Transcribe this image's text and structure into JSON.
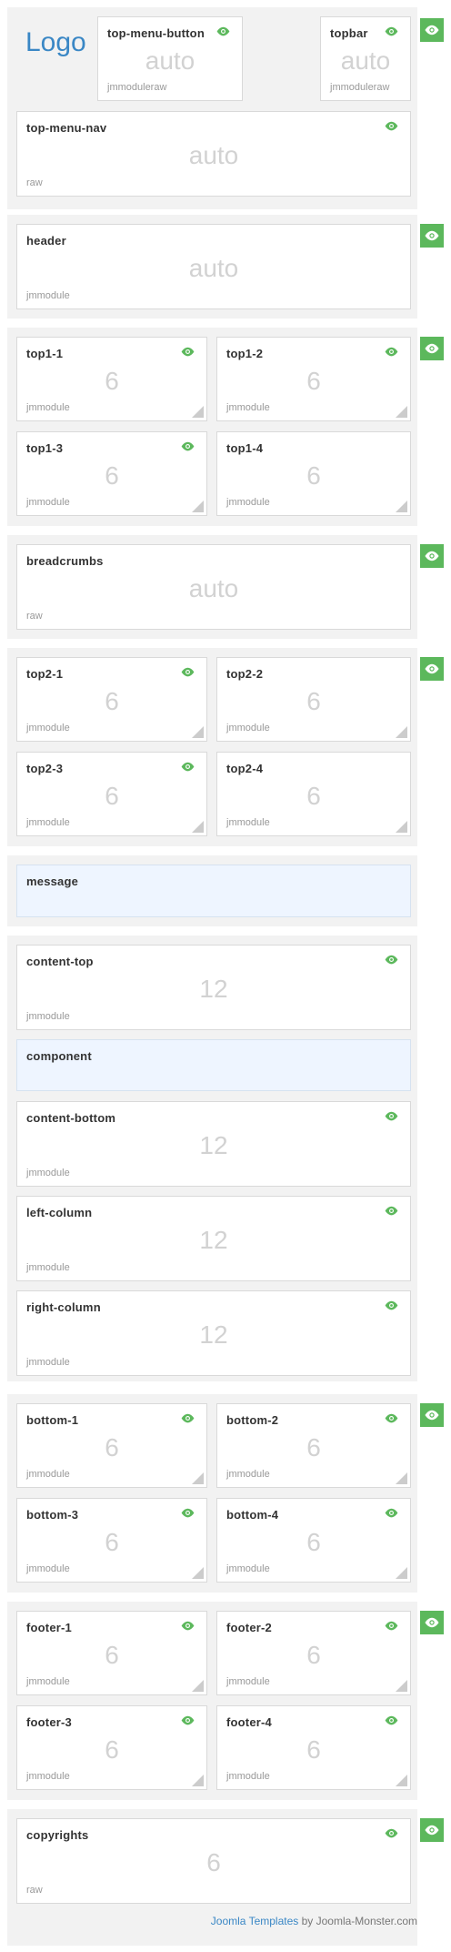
{
  "colors": {
    "accent": "#5cb85c",
    "link": "#3a87c5",
    "highlight": "#eef5ff"
  },
  "logo": {
    "text": "Logo"
  },
  "eye_icon": "eye-icon",
  "sections": {
    "s0": {
      "top_menu_button": {
        "title": "top-menu-button",
        "size": "auto",
        "type": "jmmoduleraw"
      },
      "topbar": {
        "title": "topbar",
        "size": "auto",
        "type": "jmmoduleraw"
      },
      "top_menu_nav": {
        "title": "top-menu-nav",
        "size": "auto",
        "type": "raw"
      }
    },
    "header": {
      "title": "header",
      "size": "auto",
      "type": "jmmodule"
    },
    "top1": [
      {
        "title": "top1-1",
        "size": "6",
        "type": "jmmodule"
      },
      {
        "title": "top1-2",
        "size": "6",
        "type": "jmmodule"
      },
      {
        "title": "top1-3",
        "size": "6",
        "type": "jmmodule"
      },
      {
        "title": "top1-4",
        "size": "6",
        "type": "jmmodule"
      }
    ],
    "breadcrumbs": {
      "title": "breadcrumbs",
      "size": "auto",
      "type": "raw"
    },
    "top2": [
      {
        "title": "top2-1",
        "size": "6",
        "type": "jmmodule"
      },
      {
        "title": "top2-2",
        "size": "6",
        "type": "jmmodule"
      },
      {
        "title": "top2-3",
        "size": "6",
        "type": "jmmodule"
      },
      {
        "title": "top2-4",
        "size": "6",
        "type": "jmmodule"
      }
    ],
    "message": {
      "title": "message"
    },
    "content": {
      "content_top": {
        "title": "content-top",
        "size": "12",
        "type": "jmmodule"
      },
      "component": {
        "title": "component"
      },
      "content_bottom": {
        "title": "content-bottom",
        "size": "12",
        "type": "jmmodule"
      },
      "left_column": {
        "title": "left-column",
        "size": "12",
        "type": "jmmodule"
      },
      "right_column": {
        "title": "right-column",
        "size": "12",
        "type": "jmmodule"
      }
    },
    "bottom": [
      {
        "title": "bottom-1",
        "size": "6",
        "type": "jmmodule"
      },
      {
        "title": "bottom-2",
        "size": "6",
        "type": "jmmodule"
      },
      {
        "title": "bottom-3",
        "size": "6",
        "type": "jmmodule"
      },
      {
        "title": "bottom-4",
        "size": "6",
        "type": "jmmodule"
      }
    ],
    "footer": [
      {
        "title": "footer-1",
        "size": "6",
        "type": "jmmodule"
      },
      {
        "title": "footer-2",
        "size": "6",
        "type": "jmmodule"
      },
      {
        "title": "footer-3",
        "size": "6",
        "type": "jmmodule"
      },
      {
        "title": "footer-4",
        "size": "6",
        "type": "jmmodule"
      }
    ],
    "copyrights": {
      "title": "copyrights",
      "size": "6",
      "type": "raw"
    }
  },
  "credit": {
    "link_text": "Joomla Templates",
    "rest": " by Joomla-Monster.com"
  }
}
